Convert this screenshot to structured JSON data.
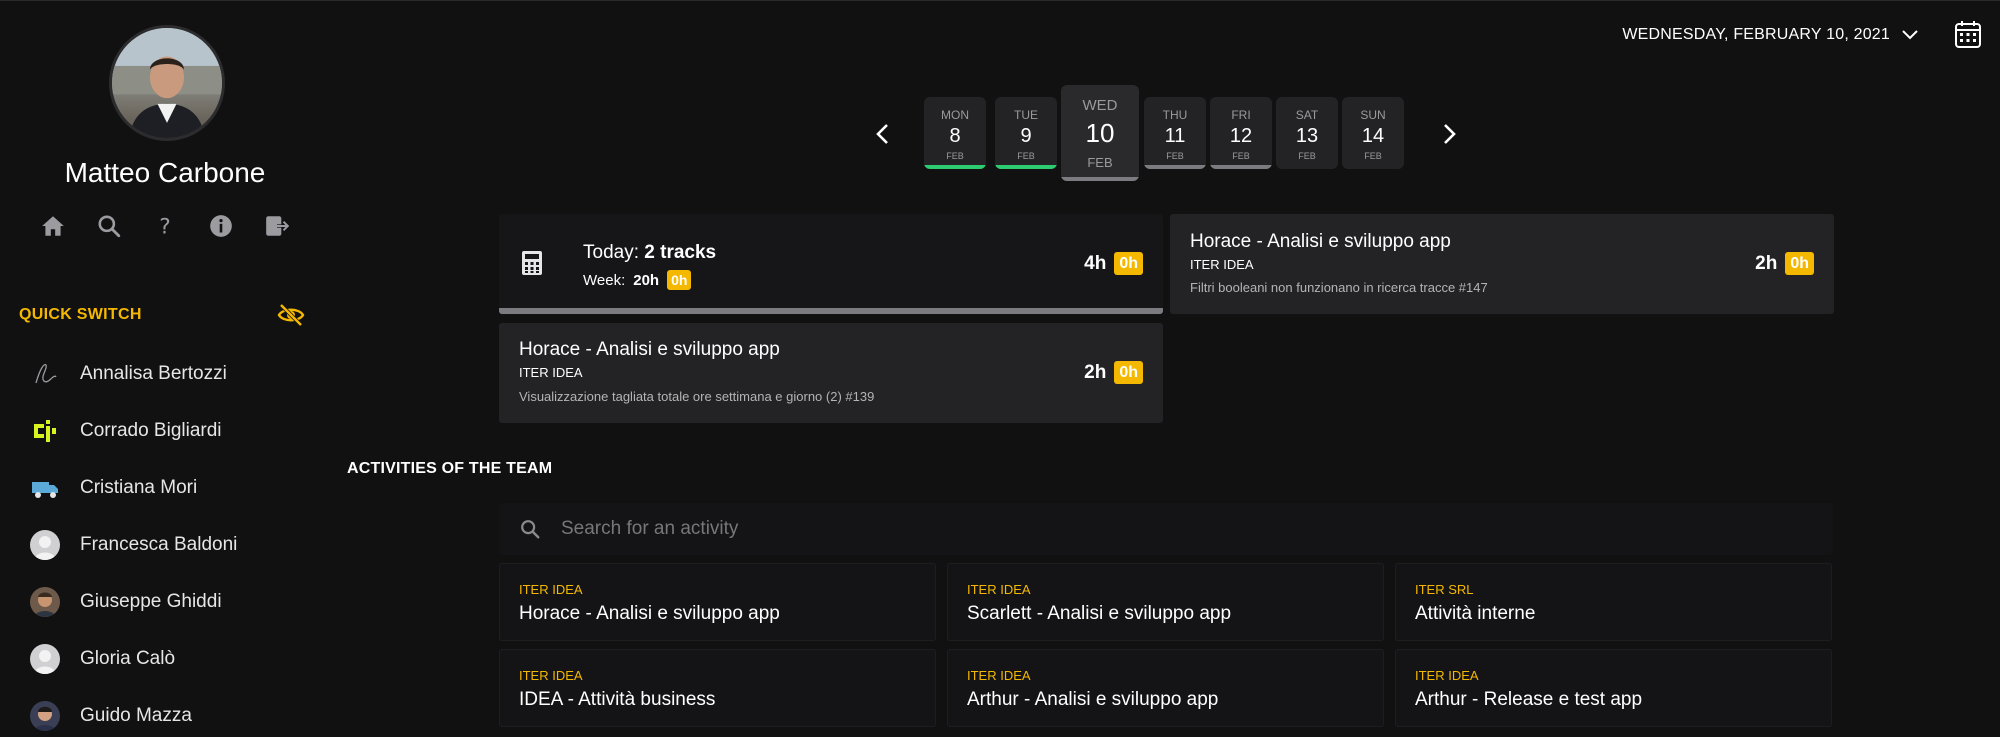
{
  "user": {
    "name": "Matteo Carbone"
  },
  "nav": {
    "icons": [
      "home-icon",
      "search-icon",
      "help-icon",
      "info-icon",
      "logout-icon"
    ]
  },
  "header": {
    "date_label": "WEDNESDAY, FEBRUARY 10, 2021"
  },
  "quick_switch": {
    "title": "QUICK SWITCH",
    "items": [
      {
        "label": "Annalisa Bertozzi",
        "icon": "signature-avatar-icon"
      },
      {
        "label": "Corrado Bigliardi",
        "icon": "ci-logo-avatar-icon"
      },
      {
        "label": "Cristiana Mori",
        "icon": "truck-avatar-icon"
      },
      {
        "label": "Francesca Baldoni",
        "icon": "default-avatar-icon"
      },
      {
        "label": "Giuseppe Ghiddi",
        "icon": "photo-avatar-icon"
      },
      {
        "label": "Gloria Calò",
        "icon": "default-avatar-icon"
      },
      {
        "label": "Guido Mazza",
        "icon": "photo-avatar-icon"
      }
    ]
  },
  "week": {
    "days": [
      {
        "dow": "MON",
        "num": "8",
        "mon": "FEB",
        "status": "green"
      },
      {
        "dow": "TUE",
        "num": "9",
        "mon": "FEB",
        "status": "green"
      },
      {
        "dow": "WED",
        "num": "10",
        "mon": "FEB",
        "status": "grey",
        "selected": true
      },
      {
        "dow": "THU",
        "num": "11",
        "mon": "FEB",
        "status": "grey"
      },
      {
        "dow": "FRI",
        "num": "12",
        "mon": "FEB",
        "status": "grey"
      },
      {
        "dow": "SAT",
        "num": "13",
        "mon": "FEB",
        "status": "none"
      },
      {
        "dow": "SUN",
        "num": "14",
        "mon": "FEB",
        "status": "none"
      }
    ]
  },
  "summary": {
    "today_label": "Today:",
    "today_value": "2 tracks",
    "week_label": "Week:",
    "week_hours": "20h",
    "week_extra": "0h",
    "hours": "4h",
    "extra": "0h"
  },
  "tracks": [
    {
      "title": "Horace - Analisi e sviluppo app",
      "client": "ITER IDEA",
      "description": "Filtri booleani non funzionano in ricerca tracce #147",
      "hours": "2h",
      "extra": "0h"
    },
    {
      "title": "Horace - Analisi e sviluppo app",
      "client": "ITER IDEA",
      "description": "Visualizzazione tagliata totale ore settimana e giorno (2) #139",
      "hours": "2h",
      "extra": "0h"
    }
  ],
  "team": {
    "title": "ACTIVITIES OF THE TEAM",
    "search_placeholder": "Search for an activity",
    "activities": [
      {
        "client": "ITER IDEA",
        "name": "Horace - Analisi e sviluppo app"
      },
      {
        "client": "ITER IDEA",
        "name": "Scarlett - Analisi e sviluppo app"
      },
      {
        "client": "ITER SRL",
        "name": "Attività interne"
      },
      {
        "client": "ITER IDEA",
        "name": "IDEA - Attività business"
      },
      {
        "client": "ITER IDEA",
        "name": "Arthur - Analisi e sviluppo app"
      },
      {
        "client": "ITER IDEA",
        "name": "Arthur - Release e test app"
      }
    ]
  },
  "colors": {
    "accent": "#f5b800",
    "background": "#111112",
    "card": "#232325",
    "status_green": "#2ecc71",
    "status_grey": "#7c7c80"
  }
}
